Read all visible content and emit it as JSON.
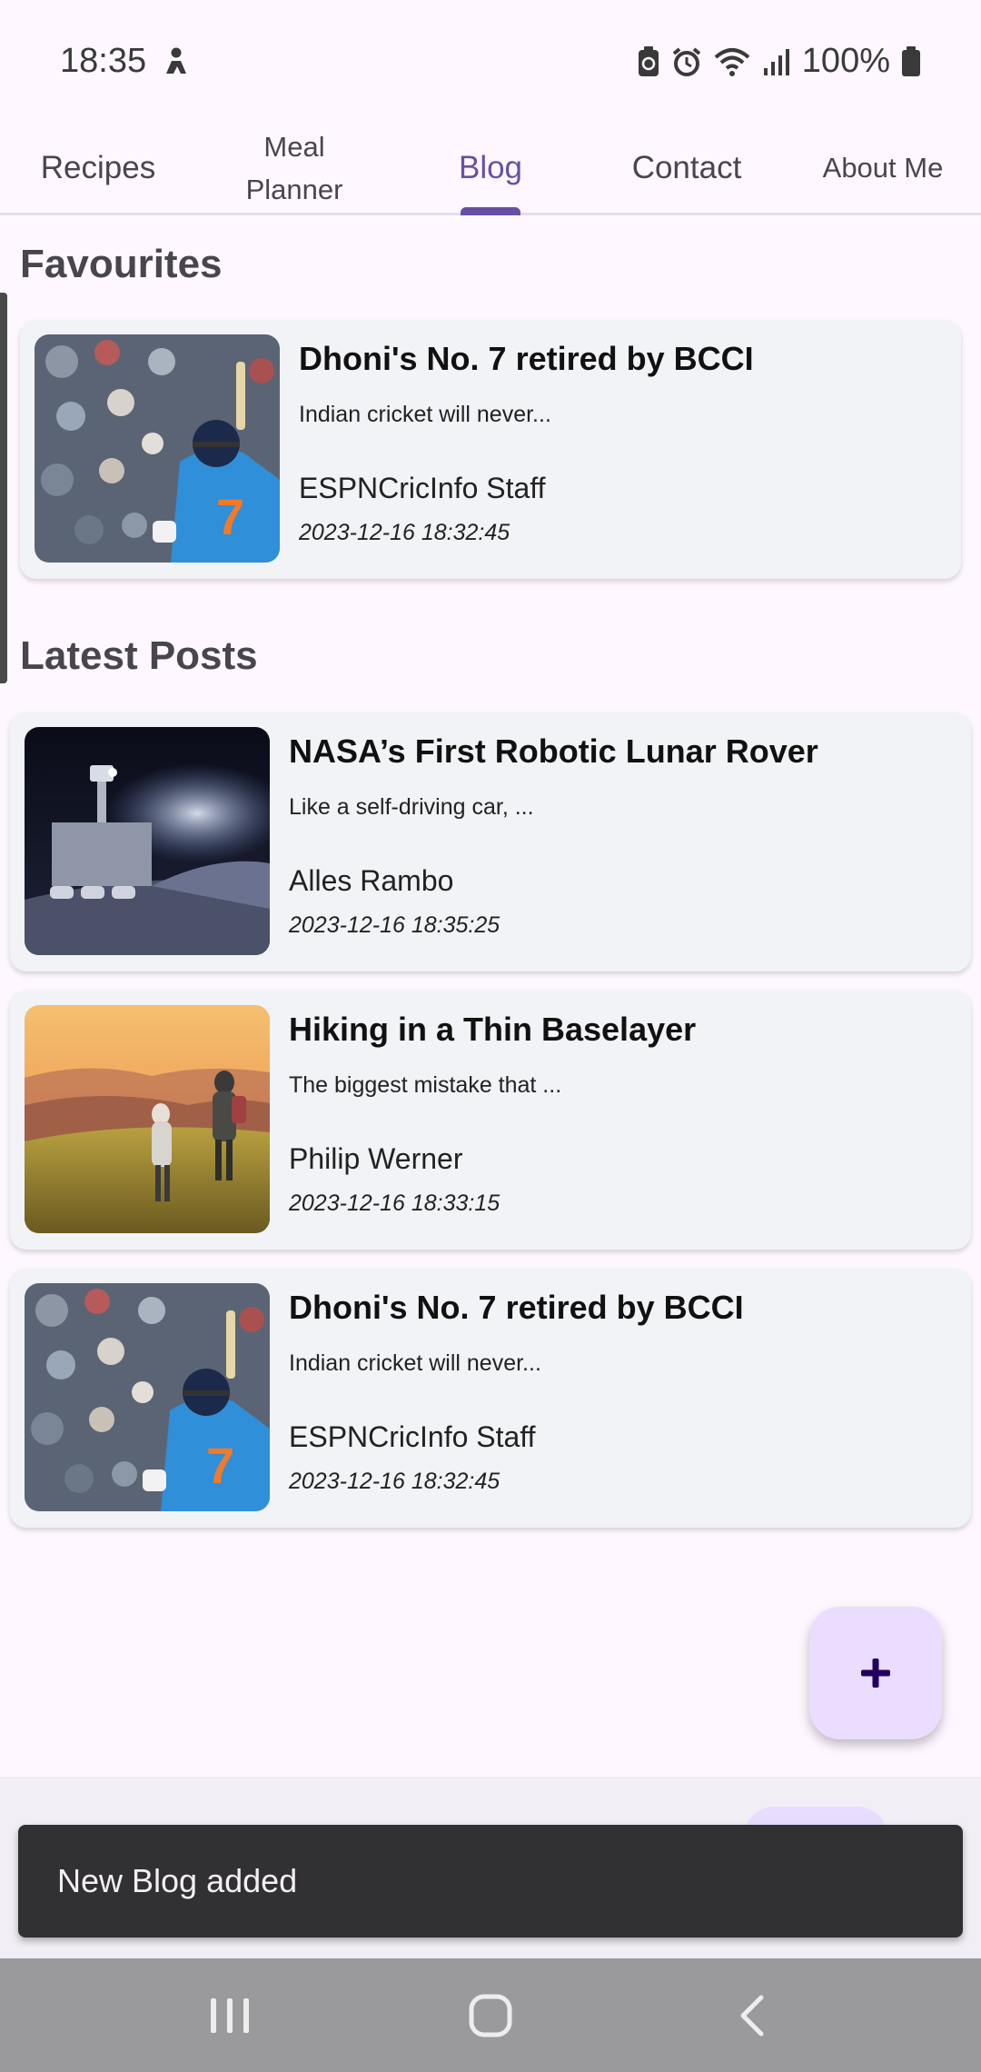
{
  "status_bar": {
    "time": "18:35",
    "battery": "100%",
    "icons": [
      "person-status-icon",
      "battery-saver-icon",
      "alarm-icon",
      "wifi-icon",
      "signal-icon",
      "battery-icon"
    ]
  },
  "tabs": [
    {
      "label": "Recipes",
      "active": false
    },
    {
      "label": "Meal\nPlanner",
      "active": false
    },
    {
      "label": "Blog",
      "active": true
    },
    {
      "label": "Contact",
      "active": false
    },
    {
      "label": "About Me",
      "active": false
    }
  ],
  "favourites": {
    "title": "Favourites",
    "posts": [
      {
        "title": "Dhoni's No. 7 retired by BCCI",
        "excerpt": "Indian cricket will never...",
        "author": "ESPNCricInfo Staff",
        "date": "2023-12-16 18:32:45",
        "image": "cricket-player-image"
      }
    ]
  },
  "latest": {
    "title": "Latest Posts",
    "posts": [
      {
        "title": "NASA’s First Robotic Lunar Rover",
        "excerpt": "Like a self-driving car, ...",
        "author": "Alles Rambo",
        "date": "2023-12-16 18:35:25",
        "image": "lunar-rover-image"
      },
      {
        "title": "Hiking in a Thin Baselayer",
        "excerpt": "The biggest mistake that ...",
        "author": "Philip Werner",
        "date": "2023-12-16 18:33:15",
        "image": "hikers-image"
      },
      {
        "title": "Dhoni's No. 7 retired by BCCI",
        "excerpt": "Indian cricket will never...",
        "author": "ESPNCricInfo Staff",
        "date": "2023-12-16 18:32:45",
        "image": "cricket-player-image"
      }
    ]
  },
  "fab": {
    "icon": "plus-icon"
  },
  "snackbar": {
    "message": "New Blog added"
  },
  "nav_bar": {
    "icons": [
      "recents-icon",
      "home-icon",
      "back-icon"
    ]
  },
  "colors": {
    "accent": "#6750a4",
    "background": "#fef7ff",
    "card": "#f2f3f6",
    "fab": "#eaddff",
    "snackbar": "#313033",
    "nav_bar": "#9a9a9c"
  }
}
